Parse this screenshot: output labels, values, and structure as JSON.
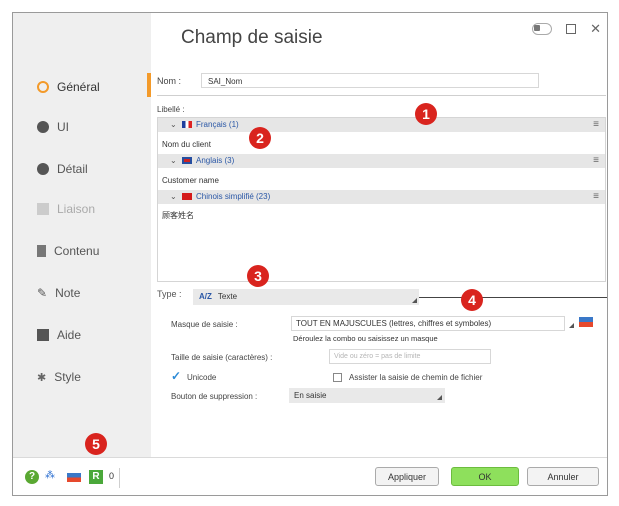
{
  "window": {
    "title": "Champ de saisie"
  },
  "sidebar": {
    "items": [
      {
        "label": "Général",
        "icon": "circle-icon",
        "state": "active"
      },
      {
        "label": "UI",
        "icon": "target-icon",
        "state": "normal"
      },
      {
        "label": "Détail",
        "icon": "plus-circle-icon",
        "state": "normal"
      },
      {
        "label": "Liaison",
        "icon": "link-box-icon",
        "state": "disabled"
      },
      {
        "label": "Contenu",
        "icon": "database-icon",
        "state": "normal"
      },
      {
        "label": "Note",
        "icon": "pencil-icon",
        "state": "normal"
      },
      {
        "label": "Aide",
        "icon": "help-box-icon",
        "state": "normal"
      },
      {
        "label": "Style",
        "icon": "style-icon",
        "state": "normal"
      }
    ]
  },
  "form": {
    "nom_label": "Nom :",
    "nom_value": "SAI_Nom",
    "libelle_label": "Libellé :",
    "languages": [
      {
        "name": "Français (1)",
        "value": "Nom du client",
        "flag": "fr-flag-icon"
      },
      {
        "name": "Anglais (3)",
        "value": "Customer name",
        "flag": "gb-flag-icon"
      },
      {
        "name": "Chinois simplifié (23)",
        "value": "顾客姓名",
        "flag": "cn-flag-icon"
      }
    ],
    "type_label": "Type :",
    "type_prefix": "A/Z",
    "type_value": "Texte",
    "masque_label": "Masque de saisie :",
    "masque_value": "TOUT EN MAJUSCULES (lettres, chiffres et symboles)",
    "masque_hint": "Déroulez la combo ou saisissez un masque",
    "taille_label": "Taille de saisie (caractères) :",
    "taille_placeholder": "Vide ou zéro = pas de limite",
    "unicode_label": "Unicode",
    "chemin_label": "Assister la saisie de chemin de fichier",
    "suppression_label": "Bouton de suppression :",
    "suppression_value": "En saisie"
  },
  "badges": [
    "1",
    "2",
    "3",
    "4",
    "5"
  ],
  "footer": {
    "help_glyph": "?",
    "r_label": "R",
    "count": "0",
    "apply_label": "Appliquer",
    "ok_label": "OK",
    "cancel_label": "Annuler"
  },
  "colors": {
    "accent": "#f39a2a",
    "badge": "#d9241e",
    "ok": "#8ee05c",
    "link": "#2a57a6"
  }
}
